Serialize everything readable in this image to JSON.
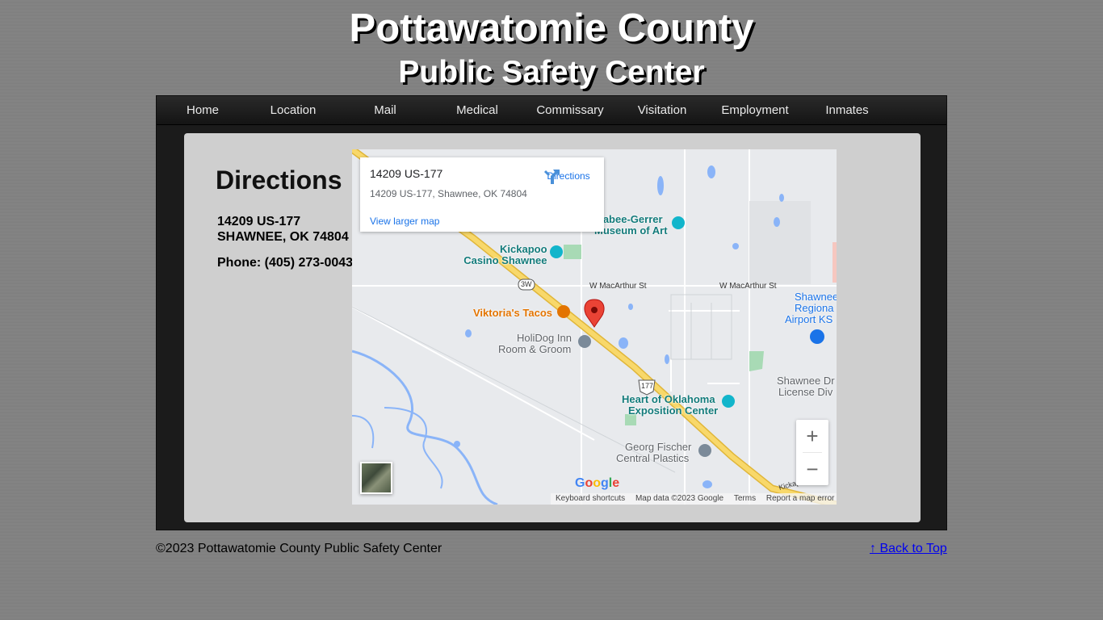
{
  "header": {
    "title_line1": "Pottawatomie County",
    "title_line2": "Public Safety Center"
  },
  "nav": {
    "items": [
      "Home",
      "Location",
      "Mail",
      "Medical",
      "Commissary",
      "Visitation",
      "Employment",
      "Inmates"
    ]
  },
  "main": {
    "heading": "Directions",
    "address_line1": "14209 US-177",
    "address_line2": "SHAWNEE, OK 74804",
    "phone": "Phone: (405) 273-0043"
  },
  "map": {
    "info_title": "14209 US-177",
    "info_address": "14209 US-177, Shawnee, OK 74804",
    "directions_label": "Directions",
    "larger_map_label": "View larger map",
    "places": {
      "mabee_gerrer_1": "Mabee-Gerrer",
      "mabee_gerrer_2": "Museum of Art",
      "kickapoo_1": "Kickapoo",
      "kickapoo_2": "Casino Shawnee",
      "viktorias": "Viktoria's Tacos",
      "holidog_1": "HoliDog Inn",
      "holidog_2": "Room & Groom",
      "shawnee_airport_1": "Shawnee",
      "shawnee_airport_2": "Regiona",
      "shawnee_airport_3": "Airport KS",
      "shawnee_driver_1": "Shawnee Dr",
      "shawnee_driver_2": "License Div",
      "heart_ok_1": "Heart of Oklahoma",
      "heart_ok_2": "Exposition Center",
      "georg_1": "Georg Fischer",
      "georg_2": "Central Plastics"
    },
    "roads": {
      "macarthur_1": "W MacArthur St",
      "macarthur_2": "W MacArthur St",
      "hwy_3w": "3W",
      "hwy_177": "177",
      "kickapoo_rd": "Kickapo"
    },
    "zoom_in": "+",
    "zoom_out": "−",
    "google_logo": "Google",
    "attribution": {
      "shortcuts": "Keyboard shortcuts",
      "data": "Map data ©2023 Google",
      "terms": "Terms",
      "report": "Report a map error"
    },
    "colors": {
      "water": "#8ab4f8",
      "highway": "#f5c542",
      "pin": "#ea4335",
      "park": "#a8dab5"
    }
  },
  "footer": {
    "copyright": "©2023 Pottawatomie County Public Safety Center",
    "back_to_top": "↑ Back to Top"
  }
}
